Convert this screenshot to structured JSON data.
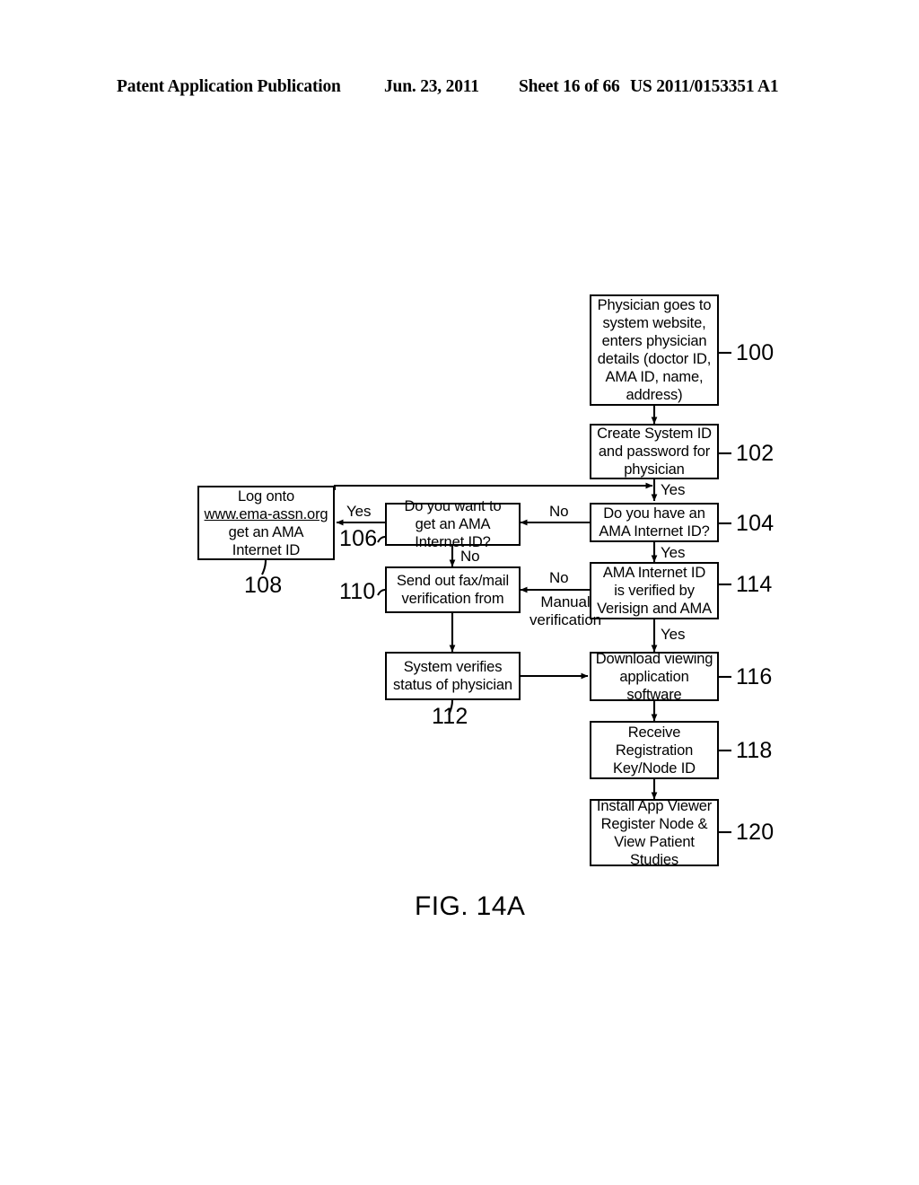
{
  "header": {
    "publication": "Patent Application Publication",
    "date": "Jun. 23, 2011",
    "sheet": "Sheet 16 of 66",
    "patent_number": "US 2011/0153351 A1"
  },
  "figure": {
    "caption": "FIG. 14A"
  },
  "chart_data": {
    "type": "diagram",
    "title": "FIG. 14A",
    "nodes": [
      {
        "ref": "100",
        "text": "Physician goes to system website, enters physician details (doctor ID, AMA ID, name, address)"
      },
      {
        "ref": "102",
        "text": "Create System ID and password for physician"
      },
      {
        "ref": "104",
        "text": "Do you have an AMA Internet ID?"
      },
      {
        "ref": "106",
        "text": "Do you want to get an AMA Internet ID?"
      },
      {
        "ref": "108",
        "text": "Log onto www.ema-assn.org get an  AMA Internet ID"
      },
      {
        "ref": "110",
        "text": "Send out fax/mail verification from"
      },
      {
        "ref": "112",
        "text": "System verifies status of physician"
      },
      {
        "ref": "114",
        "text": "AMA Internet ID is verified by Verisign and AMA"
      },
      {
        "ref": "116",
        "text": "Download viewing application software"
      },
      {
        "ref": "118",
        "text": "Receive Registration Key/Node ID"
      },
      {
        "ref": "120",
        "text": "Install App Viewer Register Node & View Patient Studies"
      }
    ],
    "edges": [
      {
        "from": "100",
        "to": "102",
        "label": ""
      },
      {
        "from": "102",
        "to": "104",
        "label": "Yes"
      },
      {
        "from": "104",
        "to": "106",
        "label": "No"
      },
      {
        "from": "104",
        "to": "114",
        "label": "Yes"
      },
      {
        "from": "106",
        "to": "108",
        "label": "Yes"
      },
      {
        "from": "106",
        "to": "110",
        "label": "No"
      },
      {
        "from": "108",
        "to": "104",
        "label": ""
      },
      {
        "from": "114",
        "to": "110",
        "label": "No\nManual verification"
      },
      {
        "from": "114",
        "to": "116",
        "label": "Yes"
      },
      {
        "from": "110",
        "to": "112",
        "label": ""
      },
      {
        "from": "112",
        "to": "116",
        "label": ""
      },
      {
        "from": "116",
        "to": "118",
        "label": ""
      },
      {
        "from": "118",
        "to": "120",
        "label": ""
      }
    ]
  },
  "boxes": {
    "b100": "Physician goes to\nsystem website,\nenters physician\ndetails (doctor ID,\nAMA ID, name,\naddress)",
    "b102": "Create System ID\nand password for\nphysician",
    "b104": "Do you have an\nAMA Internet ID?",
    "b106": "Do you want to\nget an AMA\nInternet ID?",
    "b108_line1": "Log onto",
    "b108_url": "www.ema-assn.org",
    "b108_line3": "get an  AMA",
    "b108_line4": "Internet ID",
    "b110": "Send out fax/mail\nverification from",
    "b112": "System verifies\nstatus of physician",
    "b114": "AMA Internet ID\nis verified by\nVerisign and AMA",
    "b116": "Download viewing\napplication\nsoftware",
    "b118": "Receive\nRegistration\nKey/Node ID",
    "b120": "Install App Viewer\nRegister Node &\nView Patient\nStudies"
  },
  "refs": {
    "r100": "100",
    "r102": "102",
    "r104": "104",
    "r106": "106",
    "r108": "108",
    "r110": "110",
    "r112": "112",
    "r114": "114",
    "r116": "116",
    "r118": "118",
    "r120": "120"
  },
  "edge_labels": {
    "yes_102_104": "Yes",
    "no_104_106": "No",
    "yes_104_114": "Yes",
    "yes_106_108": "Yes",
    "no_106_110": "No",
    "no_114_110": "No",
    "manual_114_110": "Manual\nverification",
    "yes_114_116": "Yes"
  }
}
